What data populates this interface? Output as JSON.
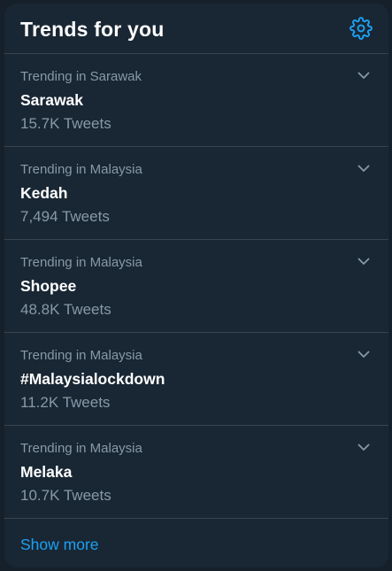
{
  "header": {
    "title": "Trends for you",
    "settings_icon": "gear-icon",
    "accent_color": "#1da1f2"
  },
  "trends": [
    {
      "context": "Trending in Sarawak",
      "name": "Sarawak",
      "count": "15.7K Tweets"
    },
    {
      "context": "Trending in Malaysia",
      "name": "Kedah",
      "count": "7,494 Tweets"
    },
    {
      "context": "Trending in Malaysia",
      "name": "Shopee",
      "count": "48.8K Tweets"
    },
    {
      "context": "Trending in Malaysia",
      "name": "#Malaysialockdown",
      "count": "11.2K Tweets"
    },
    {
      "context": "Trending in Malaysia",
      "name": "Melaka",
      "count": "10.7K Tweets"
    }
  ],
  "footer": {
    "show_more_label": "Show more"
  }
}
